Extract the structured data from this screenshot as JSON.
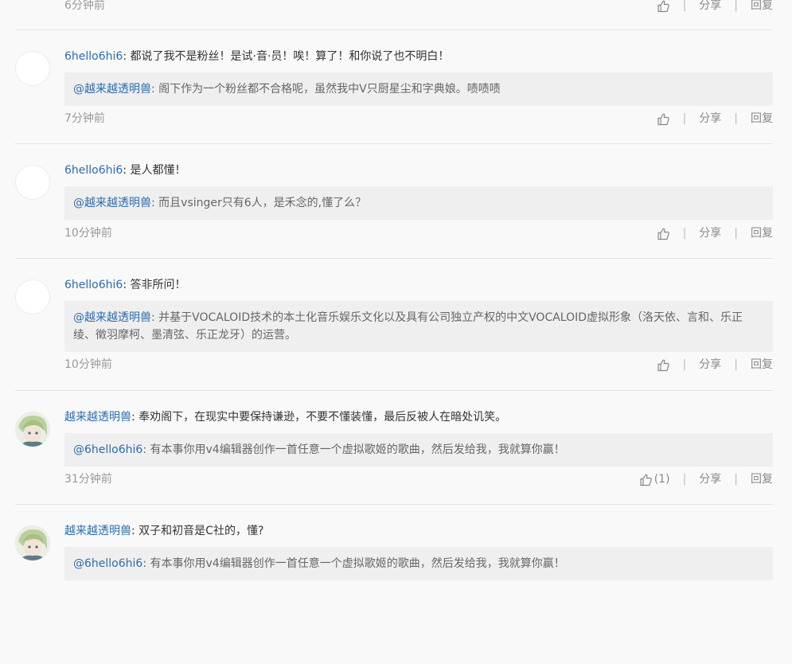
{
  "ui": {
    "share_label": "分享",
    "reply_label": "回复",
    "separator": "|"
  },
  "comments": [
    {
      "time": "6分钟前",
      "like_count": ""
    },
    {
      "user": "6hello6hi6",
      "text": "都说了我不是粉丝！是试·音·员！唉！算了！和你说了也不明白！",
      "quote_user": "@越来越透明兽",
      "quote_text": "阁下作为一个粉丝都不合格呢，虽然我中V只厨星尘和字典娘。啧啧啧",
      "time": "7分钟前",
      "like_count": ""
    },
    {
      "user": "6hello6hi6",
      "text": "是人都懂！",
      "quote_user": "@越来越透明兽",
      "quote_text": "而且vsinger只有6人，是禾念的,懂了么？",
      "time": "10分钟前",
      "like_count": ""
    },
    {
      "user": "6hello6hi6",
      "text": "答非所问！",
      "quote_user": "@越来越透明兽",
      "quote_text": "并基于VOCALOID技术的本土化音乐娱乐文化以及具有公司独立产权的中文VOCALOID虚拟形象（洛天依、言和、乐正绫、徵羽摩柯、墨清弦、乐正龙牙）的运营。",
      "time": "10分钟前",
      "like_count": ""
    },
    {
      "user": "越来越透明兽",
      "text": "奉劝阁下，在现实中要保持谦逊，不要不懂装懂，最后反被人在暗处讥笑。",
      "quote_user": "@6hello6hi6",
      "quote_text": "有本事你用v4编辑器创作一首任意一个虚拟歌姬的歌曲，然后发给我，我就算你赢！",
      "time": "31分钟前",
      "like_count": "(1)"
    },
    {
      "user": "越来越透明兽",
      "text": "双子和初音是C社的，懂?",
      "quote_user": "@6hello6hi6",
      "quote_text": "有本事你用v4编辑器创作一首任意一个虚拟歌姬的歌曲，然后发给我，我就算你赢！"
    }
  ]
}
